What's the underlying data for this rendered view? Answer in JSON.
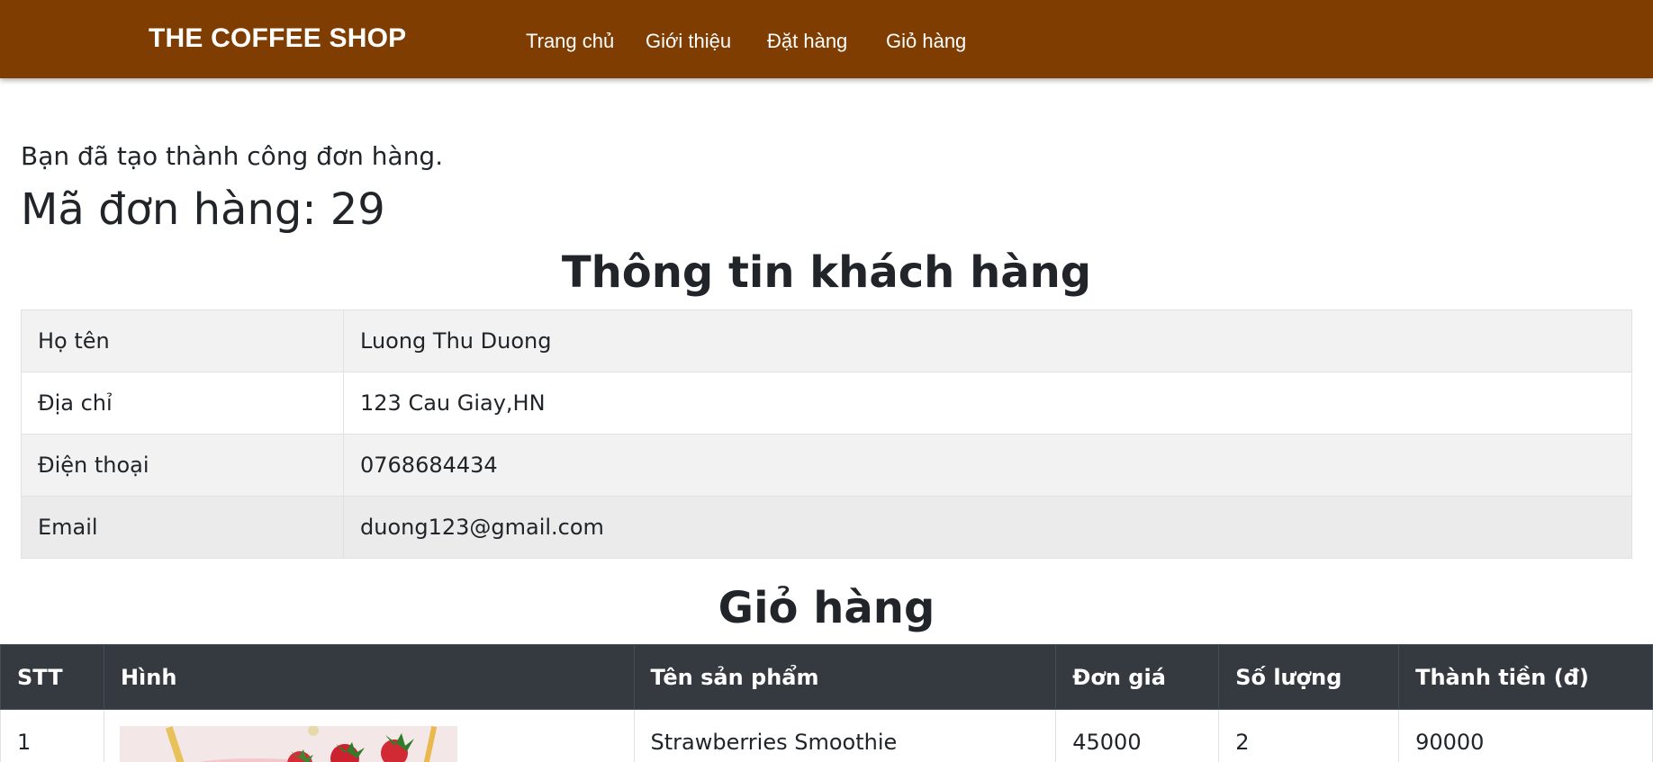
{
  "nav": {
    "brand": "THE COFFEE SHOP",
    "links": [
      "Trang chủ",
      "Giới thiệu",
      "Đặt hàng",
      "Giỏ hàng"
    ]
  },
  "order": {
    "success_message": "Bạn đã tạo thành công đơn hàng.",
    "code_label": "Mã đơn hàng: 29"
  },
  "customer": {
    "title": "Thông tin khách hàng",
    "rows": [
      {
        "label": "Họ tên",
        "value": "Luong Thu Duong"
      },
      {
        "label": "Địa chỉ",
        "value": "123 Cau Giay,HN"
      },
      {
        "label": "Điện thoại",
        "value": "0768684434"
      },
      {
        "label": "Email",
        "value": "duong123@gmail.com"
      }
    ]
  },
  "cart": {
    "title": "Giỏ hàng",
    "headers": [
      "STT",
      "Hình",
      "Tên sản phẩm",
      "Đơn giá",
      "Số lượng",
      "Thành tiền (đ)"
    ],
    "rows": [
      {
        "stt": "1",
        "image": "strawberry-smoothie-image",
        "name": "Strawberries Smoothie",
        "price": "45000",
        "qty": "2",
        "total": "90000"
      }
    ]
  },
  "colors": {
    "navbar": "#7f3d02",
    "table_header": "#343a40"
  }
}
